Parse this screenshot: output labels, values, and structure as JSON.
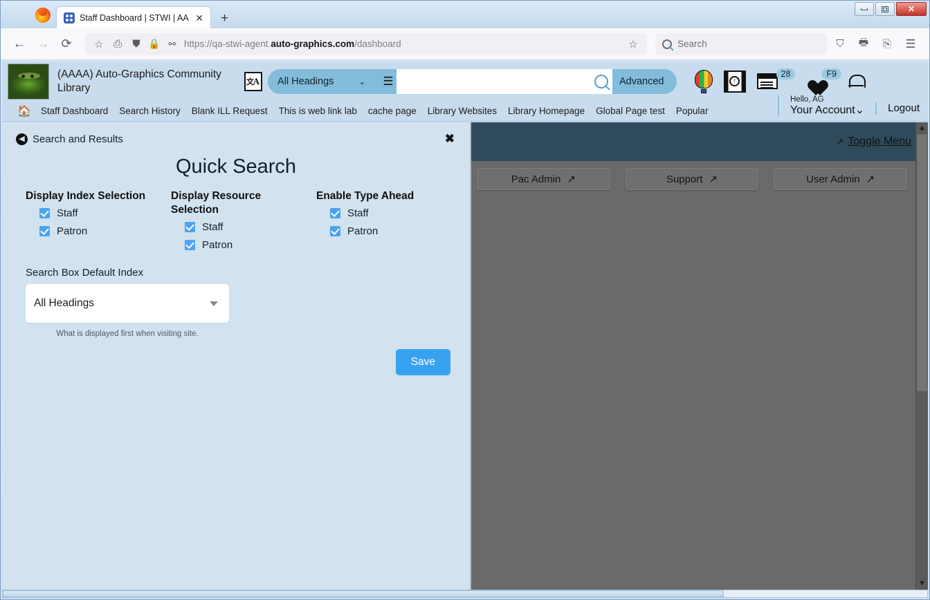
{
  "browser": {
    "window_controls": {
      "minimize": "minimize",
      "maximize": "maximize",
      "close": "✕"
    },
    "tab": {
      "title": "Staff Dashboard | STWI | AAAA",
      "close_label": "✕",
      "new_tab_label": "+"
    },
    "toolbar": {
      "back": "←",
      "forward": "→",
      "reload": "⟳",
      "bookmark": "☆",
      "save_to_pocket_alt": "⎙",
      "shield": "shield",
      "lock": "lock",
      "permissions": "permissions",
      "url_prefix": "https://qa-stwi-agent.",
      "url_domain": "auto-graphics.com",
      "url_suffix": "/dashboard",
      "star": "☆",
      "search_placeholder": "Search",
      "pocket": "pocket",
      "print": "print",
      "extensions": "extensions",
      "menu": "☰"
    }
  },
  "site_header": {
    "library_name": "(AAAA) Auto-Graphics Community Library",
    "language_icon": "translate-icon",
    "index_selected": "All Headings",
    "chevron": "⌄",
    "database_icon": "database-icon",
    "search_value": "",
    "search_icon": "search-icon",
    "advanced_label": "Advanced",
    "balloon_icon": "hot-air-balloon-icon",
    "film_search_icon": "film-search-icon",
    "list_icon": "list-icon",
    "list_badge": "28",
    "heart_icon": "heart-icon",
    "heart_badge": "F9",
    "bell_icon": "notification-bell-icon"
  },
  "site_nav": {
    "home_icon": "home-icon",
    "links": [
      "Staff Dashboard",
      "Search History",
      "Blank ILL Request",
      "This is web link lab",
      "cache page",
      "Library Websites",
      "Library Homepage",
      "Global Page test",
      "Popular"
    ],
    "account": {
      "hello": "Hello, AG",
      "name": "Your Account",
      "chevron": "⌄"
    },
    "logout": "Logout"
  },
  "settings_panel": {
    "back_icon": "back-arrow-icon",
    "breadcrumb": "Search and Results",
    "close_label": "✖",
    "title": "Quick Search",
    "columns": [
      {
        "title": "Display Index Selection",
        "options": [
          {
            "label": "Staff",
            "checked": true
          },
          {
            "label": "Patron",
            "checked": true
          }
        ]
      },
      {
        "title": "Display Resource Selection",
        "options": [
          {
            "label": "Staff",
            "checked": true
          },
          {
            "label": "Patron",
            "checked": true
          }
        ]
      },
      {
        "title": "Enable Type Ahead",
        "options": [
          {
            "label": "Staff",
            "checked": true
          },
          {
            "label": "Patron",
            "checked": true
          }
        ]
      }
    ],
    "default_index": {
      "label": "Search Box Default Index",
      "value": "All Headings",
      "help": "What is displayed first when visiting site."
    },
    "save_label": "Save"
  },
  "dashboard": {
    "toggle_menu": "Toggle Menu",
    "expand_icon": "expand-arrows-icon",
    "buttons": [
      {
        "label": "Pac Admin",
        "icon": "external-link-icon"
      },
      {
        "label": "Support",
        "icon": "external-link-icon"
      },
      {
        "label": "User Admin",
        "icon": "external-link-icon"
      }
    ]
  },
  "colors": {
    "page_bg": "#c8dced",
    "panel_bg": "#d2e2ee",
    "accent_blue": "#83bcdb",
    "checkbox_blue": "#4da3f0",
    "save_blue": "#39a2f0",
    "dash_header": "#2f4a5a",
    "dim_overlay": "#6a6a6a"
  }
}
